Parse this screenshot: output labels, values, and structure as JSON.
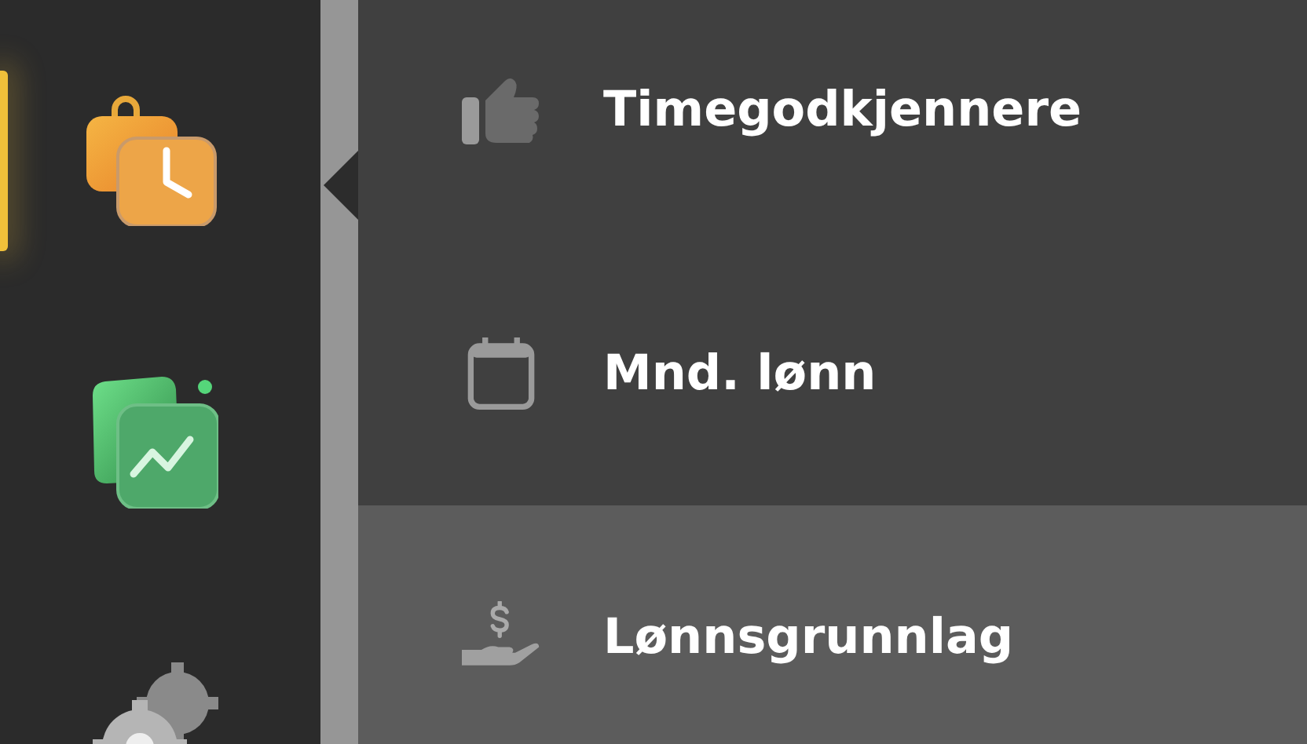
{
  "rail": {
    "items": [
      {
        "kind": "timesheet",
        "selected": true,
        "notification": false
      },
      {
        "kind": "chart",
        "selected": false,
        "notification": true
      },
      {
        "kind": "settings",
        "selected": false,
        "notification": false
      }
    ]
  },
  "menu": {
    "items": [
      {
        "kind": "approvers",
        "label": "Timegodkjennere",
        "selected": false
      },
      {
        "kind": "monthly",
        "label": "Mnd. lønn",
        "selected": false
      },
      {
        "kind": "payroll",
        "label": "Lønnsgrunnlag",
        "selected": true
      }
    ]
  }
}
